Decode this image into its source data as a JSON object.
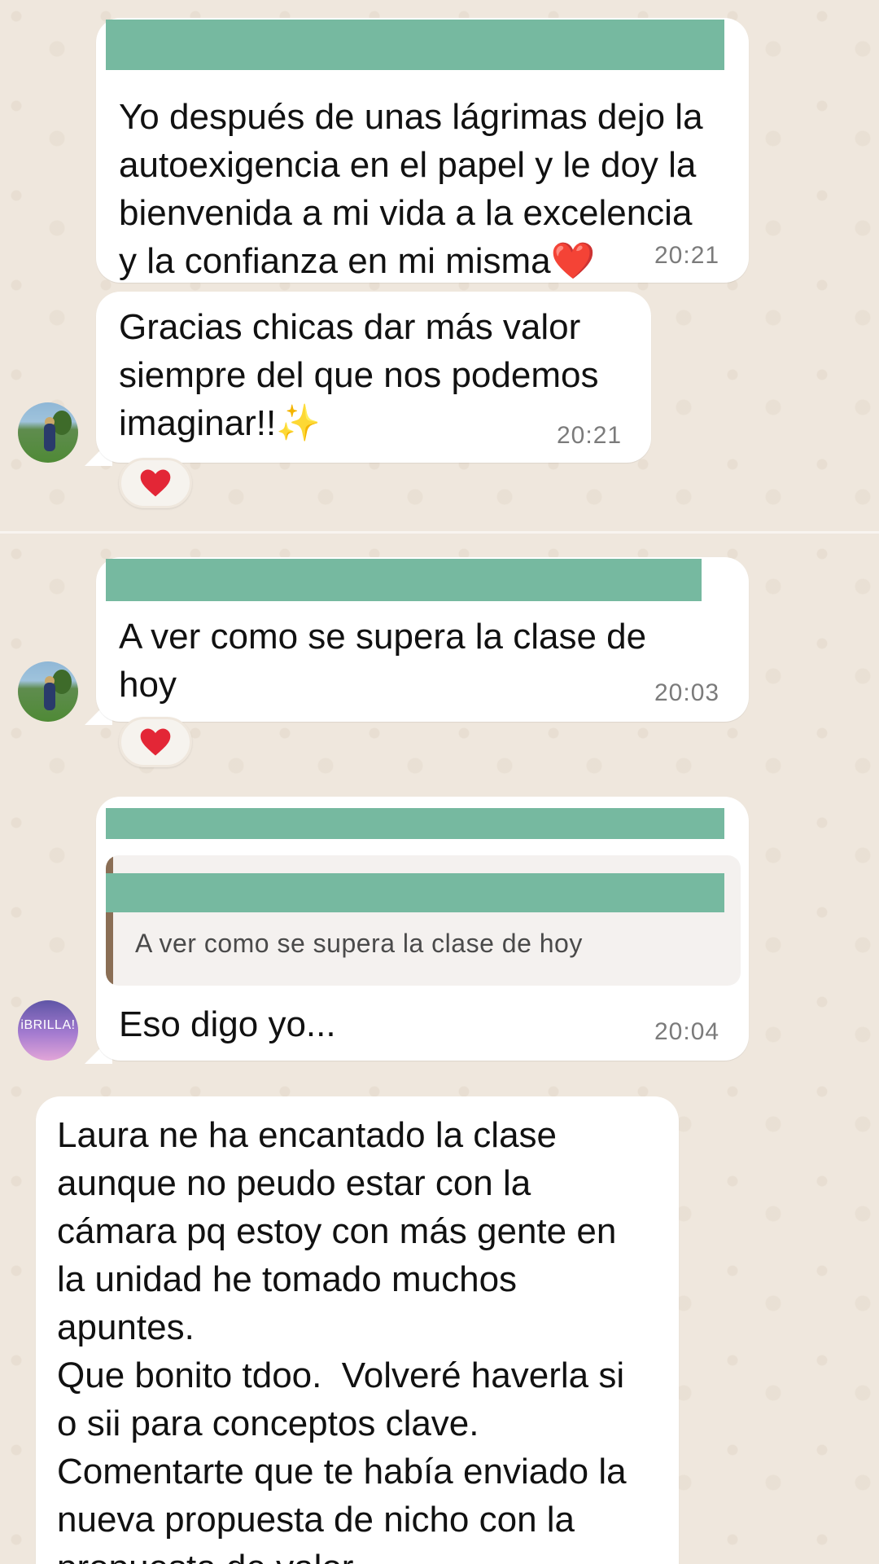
{
  "messages": [
    {
      "id": "m1",
      "text": "Yo después de unas lágrimas dejo la\nautoexigencia en el papel y le doy la\nbienvenida a mi vida a la excelencia\ny la confianza en mi misma",
      "emoji": "❤️",
      "time": "20:21"
    },
    {
      "id": "m2",
      "text": "Gracias chicas dar más valor\nsiempre del que nos podemos\nimaginar!!",
      "emoji": "✨",
      "time": "20:21",
      "reaction": "❤️"
    },
    {
      "id": "m3",
      "text": "A ver como se supera la clase de\nhoy",
      "time": "20:03",
      "reaction": "❤️"
    },
    {
      "id": "m4",
      "quoted_text": "A ver como se supera la clase de hoy",
      "text": "Eso digo yo...",
      "time": "20:04"
    },
    {
      "id": "m5",
      "text": "Laura ne ha encantado la clase\naunque no peudo estar con la\ncámara pq estoy con más gente en\nla unidad he tomado muchos\napuntes.\nQue bonito tdoo.  Volveré haverla si\no sii para conceptos clave.\nComentarte que te había enviado la\nnueva propuesta de nicho con la\npropuesta de valor"
    }
  ],
  "avatars": {
    "brilla_label": "iBRILLA!"
  },
  "colors": {
    "chat_background": "#efe7dd",
    "bubble": "#ffffff",
    "redaction": "#76b9a0",
    "timestamp": "#7b7b7b",
    "quote_bar": "#8a6e55"
  }
}
